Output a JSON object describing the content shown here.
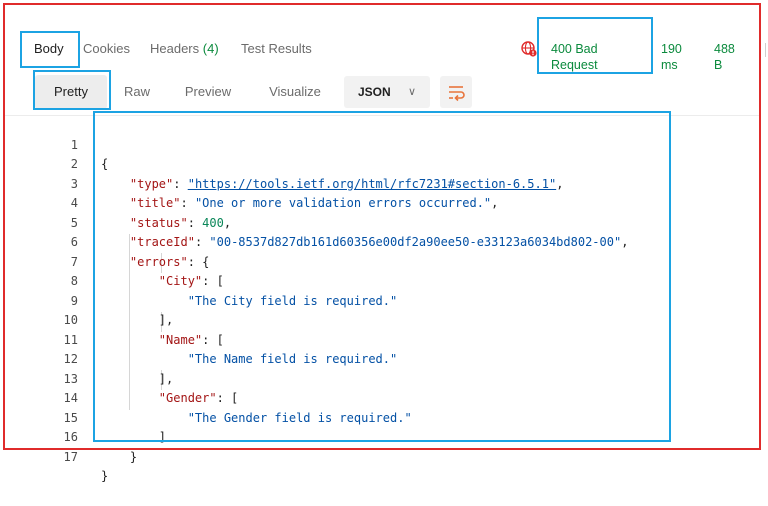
{
  "tabs": [
    {
      "label": "Body",
      "active": true
    },
    {
      "label": "Cookies"
    },
    {
      "label": "Headers",
      "count": "(4)"
    },
    {
      "label": "Test Results"
    }
  ],
  "response": {
    "status": "400 Bad Request",
    "time": "190 ms",
    "size": "488 B"
  },
  "views": [
    "Pretty",
    "Raw",
    "Preview",
    "Visualize"
  ],
  "format": "JSON",
  "colors": {
    "highlight": "#1ca3e3",
    "frame": "#e02b2b",
    "status": "#0b8a3d",
    "key": "#a31515",
    "string": "#0451a5"
  },
  "code": {
    "line_numbers": [
      "1",
      "2",
      "3",
      "4",
      "5",
      "6",
      "7",
      "8",
      "9",
      "10",
      "11",
      "12",
      "13",
      "14",
      "15",
      "16",
      "17"
    ],
    "type_key": "\"type\"",
    "type_val": "\"https://tools.ietf.org/html/rfc7231#section-6.5.1\"",
    "title_key": "\"title\"",
    "title_val": "\"One or more validation errors occurred.\"",
    "status_key": "\"status\"",
    "status_val": "400",
    "traceId_key": "\"traceId\"",
    "traceId_val": "\"00-8537d827db161d60356e00df2a90ee50-e33123a6034bd802-00\"",
    "errors_key": "\"errors\"",
    "city_key": "\"City\"",
    "city_msg": "\"The City field is required.\"",
    "name_key": "\"Name\"",
    "name_msg": "\"The Name field is required.\"",
    "gender_key": "\"Gender\"",
    "gender_msg": "\"The Gender field is required.\""
  }
}
